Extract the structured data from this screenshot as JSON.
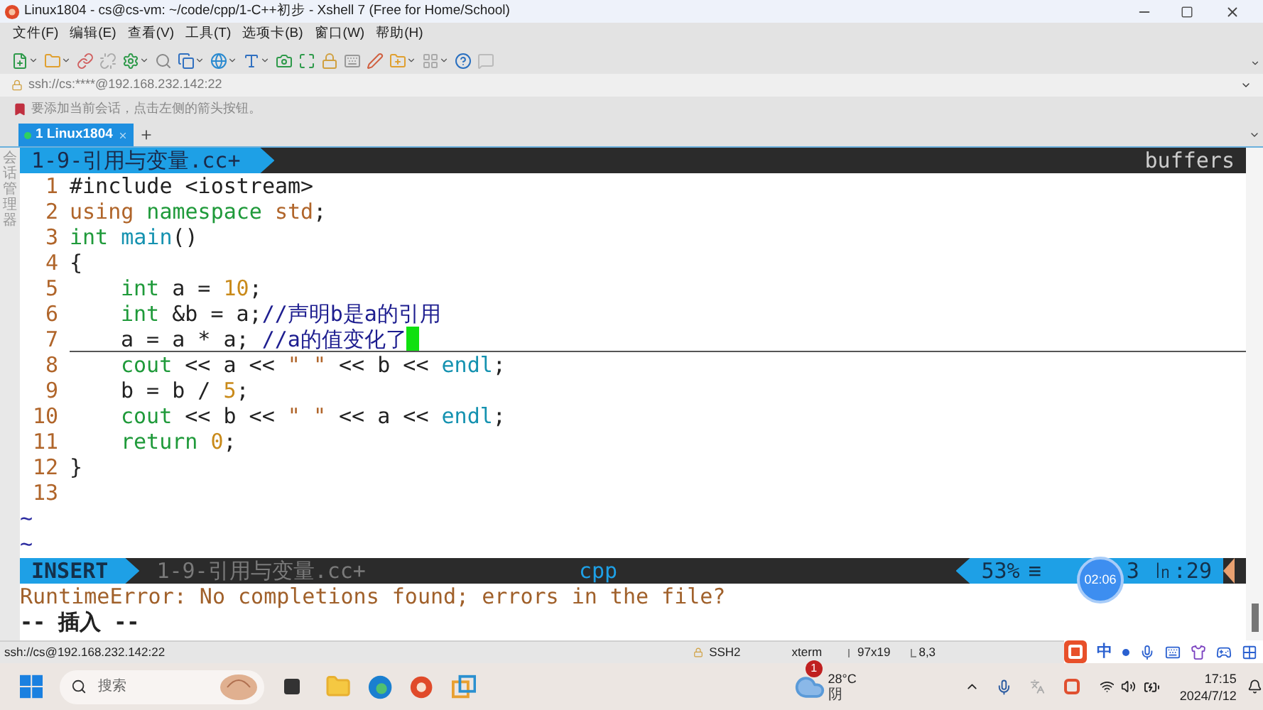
{
  "window": {
    "title": "Linux1804 - cs@cs-vm: ~/code/cpp/1-C++初步 - Xshell 7 (Free for Home/School)"
  },
  "menu": [
    "文件(F)",
    "编辑(E)",
    "查看(V)",
    "工具(T)",
    "选项卡(B)",
    "窗口(W)",
    "帮助(H)"
  ],
  "address_bar": {
    "value": "ssh://cs:****@192.168.232.142:22"
  },
  "notice": "要添加当前会话，点击左侧的箭头按钮。",
  "side_panel": {
    "label": "会话管理器"
  },
  "session_tabs": [
    {
      "label": "1 Linux1804",
      "selected": true
    }
  ],
  "editor": {
    "file_tab": "1-9-引用与变量.cc+",
    "buffers_label": "buffers",
    "lines": [
      {
        "number": "1",
        "cursor": false,
        "indented": false,
        "tokens": [
          {
            "kind": "plain",
            "text": "#include <iostream>"
          }
        ]
      },
      {
        "number": "2",
        "cursor": false,
        "indented": false,
        "tokens": [
          {
            "kind": "special",
            "text": "using"
          },
          {
            "kind": "keyword",
            "text": " namespace"
          },
          {
            "kind": "special",
            "text": " std"
          },
          {
            "kind": "plain",
            "text": ";"
          }
        ]
      },
      {
        "number": "3",
        "cursor": false,
        "indented": false,
        "tokens": [
          {
            "kind": "keyword",
            "text": "int"
          },
          {
            "kind": "function",
            "text": " main"
          },
          {
            "kind": "plain",
            "text": "()"
          }
        ]
      },
      {
        "number": "4",
        "cursor": false,
        "indented": false,
        "tokens": [
          {
            "kind": "plain",
            "text": "{"
          }
        ]
      },
      {
        "number": "5",
        "cursor": false,
        "indented": true,
        "tokens": [
          {
            "kind": "keyword",
            "text": "int"
          },
          {
            "kind": "plain",
            "text": " a = "
          },
          {
            "kind": "number",
            "text": "10"
          },
          {
            "kind": "plain",
            "text": ";"
          }
        ]
      },
      {
        "number": "6",
        "cursor": false,
        "indented": true,
        "tokens": [
          {
            "kind": "keyword",
            "text": "int"
          },
          {
            "kind": "plain",
            "text": " &b = a;"
          },
          {
            "kind": "comment",
            "text": "//声明b是a的引用"
          }
        ]
      },
      {
        "number": "7",
        "cursor": true,
        "indented": true,
        "tokens": [
          {
            "kind": "plain",
            "text": "a = a * a; "
          },
          {
            "kind": "comment",
            "text": "//a的值变化了"
          }
        ]
      },
      {
        "number": "8",
        "cursor": false,
        "indented": true,
        "tokens": [
          {
            "kind": "keyword",
            "text": "cout"
          },
          {
            "kind": "plain",
            "text": " << a << "
          },
          {
            "kind": "string",
            "text": "\" \""
          },
          {
            "kind": "plain",
            "text": " << b << "
          },
          {
            "kind": "function",
            "text": "endl"
          },
          {
            "kind": "plain",
            "text": ";"
          }
        ]
      },
      {
        "number": "9",
        "cursor": false,
        "indented": true,
        "tokens": [
          {
            "kind": "plain",
            "text": "b = b / "
          },
          {
            "kind": "number",
            "text": "5"
          },
          {
            "kind": "plain",
            "text": ";"
          }
        ]
      },
      {
        "number": "10",
        "cursor": false,
        "indented": true,
        "tokens": [
          {
            "kind": "keyword",
            "text": "cout"
          },
          {
            "kind": "plain",
            "text": " << b << "
          },
          {
            "kind": "string",
            "text": "\" \""
          },
          {
            "kind": "plain",
            "text": " << a << "
          },
          {
            "kind": "function",
            "text": "endl"
          },
          {
            "kind": "plain",
            "text": ";"
          }
        ]
      },
      {
        "number": "11",
        "cursor": false,
        "indented": true,
        "tokens": [
          {
            "kind": "keyword",
            "text": "return"
          },
          {
            "kind": "number",
            "text": " 0"
          },
          {
            "kind": "plain",
            "text": ";"
          }
        ]
      },
      {
        "number": "12",
        "cursor": false,
        "indented": false,
        "tokens": [
          {
            "kind": "plain",
            "text": "}"
          }
        ]
      },
      {
        "number": "13",
        "cursor": false,
        "indented": false
      }
    ],
    "empty_markers": [
      "~",
      "~"
    ],
    "statusline": {
      "mode": "INSERT",
      "file": "1-9-引用与变量.cc+",
      "filetype": "cpp",
      "percent": "53%",
      "symbol": "≡",
      "position": "3 ㏑:29"
    },
    "message": "RuntimeError: No completions found; errors in the file?",
    "mode_message": "-- 插入 --"
  },
  "recording_timer": "02:06",
  "status_bar": {
    "address": "ssh://cs@192.168.232.142:22",
    "protocol": "SSH2",
    "terminal": "xterm",
    "size": "97x19",
    "cursor": "8,3"
  },
  "ime_toolbar": {
    "mode": "中"
  },
  "taskbar": {
    "search_placeholder": "搜索",
    "weather": {
      "badge": "1",
      "temperature": "28°C",
      "condition": "阴"
    },
    "time": "17:15",
    "date": "2024/7/12"
  }
}
